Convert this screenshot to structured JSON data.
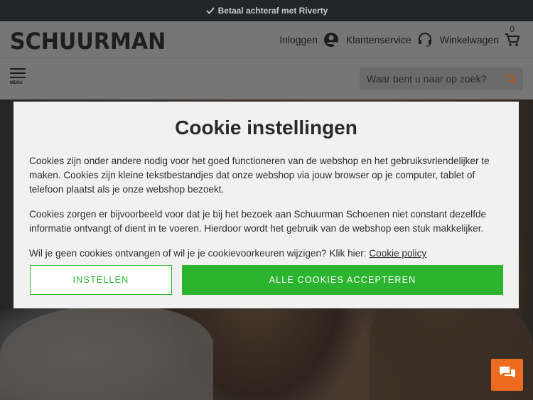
{
  "topbar": {
    "text": "Betaal achteraf met Riverty"
  },
  "header": {
    "logo": "SCHUURMAN",
    "login_label": "Inloggen",
    "service_label": "Klantenservice",
    "cart_label": "Winkelwagen",
    "cart_count": "0"
  },
  "subheader": {
    "menu_label": "MENU",
    "search_placeholder": "Waar bent u naar op zoek?"
  },
  "cookie_modal": {
    "title": "Cookie instellingen",
    "paragraph1": "Cookies zijn onder andere nodig voor het goed functioneren van de webshop en het gebruiksvriendelijker te maken. Cookies zijn kleine tekstbestandjes dat onze webshop via jouw browser op je computer, tablet of telefoon plaatst als je onze webshop bezoekt.",
    "paragraph2": "Cookies zorgen er bijvoorbeeld voor dat je bij het bezoek aan Schuurman Schoenen niet constant dezelfde informatie ontvangt of dient in te voeren. Hierdoor wordt het gebruik van de webshop een stuk makkelijker.",
    "paragraph3": "Wil je geen cookies ontvangen of wil je je cookievoorkeuren wijzigen? Klik hier:",
    "policy_link": "Cookie policy",
    "settings_button": "INSTELLEN",
    "accept_button": "ALLE COOKIES ACCEPTEREN"
  },
  "colors": {
    "accent_green": "#2bb52f",
    "chat_orange": "#ec6b1e",
    "topbar_bg": "#222629"
  },
  "icons": [
    "check-icon",
    "user-icon",
    "headset-icon",
    "cart-icon",
    "search-icon",
    "chat-icon"
  ]
}
